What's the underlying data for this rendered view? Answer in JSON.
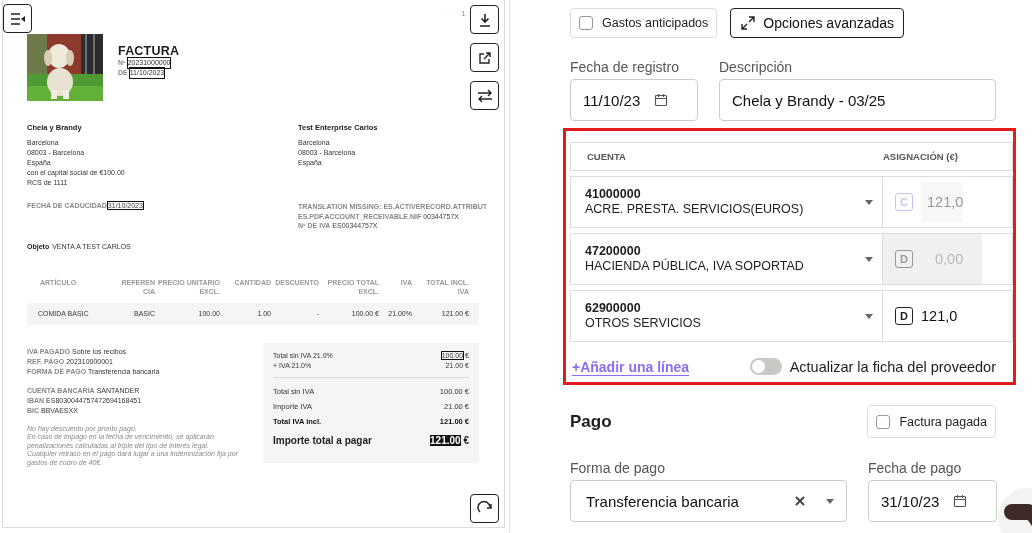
{
  "page_marker": "1",
  "invoice": {
    "title": "FACTURA",
    "number": {
      "label": "Nº",
      "value": "20231000000",
      "boxed": true
    },
    "date": {
      "label": "DE",
      "value": "11/10/2023",
      "boxed": true
    },
    "seller": {
      "name": "Chela y Brandy",
      "lines": [
        "Barcelona",
        "08003 - Barcelona",
        "España",
        "con el capital social de €100.00",
        "RCS de 1111"
      ]
    },
    "due": {
      "label": "FECHA DE CADUCIDAD",
      "value": "31/10/2023",
      "boxed": true
    },
    "client": {
      "name": "Test Enterprise Carlos",
      "lines": [
        "Barcelona",
        "08003 - Barcelona",
        "España"
      ]
    },
    "client_ids": [
      {
        "label": "TRANSLATION MISSING: ES.ACTIVERECORD.ATTRIBUTES.PDF.ACCOUNT_RECEIVABLE.NIF",
        "value": "00344757X"
      },
      {
        "label": "Nº DE IVA",
        "value": "ES00344757X"
      }
    ],
    "subject": {
      "label": "Objeto",
      "value": "VENTA A TEST CARLOS"
    },
    "columns": [
      "ARTÍCULO",
      "REFERENCIA",
      "PRECIO UNITARIO EXCL.",
      "CANTIDAD",
      "DESCUENTO",
      "PRECIO TOTAL EXCL.",
      "IVA",
      "TOTAL INCL. IVA"
    ],
    "rows": [
      [
        "COMIDA BASIC",
        "BASIC",
        "100.00",
        "1.00",
        "-",
        "100.00 €",
        "21.00%",
        "121.00 €"
      ]
    ],
    "payment_info": [
      {
        "label": "IVA PAGADO",
        "value": "Sobre los recibos"
      },
      {
        "label": "REF. PAGO",
        "value": "202310000001"
      },
      {
        "label": "FORMA DE PAGO",
        "value": "Transferencia bancaria"
      }
    ],
    "bank": [
      {
        "label": "CUENTA BANCARIA",
        "value": "SANTANDER"
      },
      {
        "label": "IBAN",
        "value": "ES8030044757472694168451"
      },
      {
        "label": "BIC",
        "value": "BBVAESXX"
      }
    ],
    "notes": [
      "No hay descuento por pronto pago.",
      "En caso de impago en la fecha de vencimiento, se aplicarán penalizaciones calculadas al triple del tipo de interés legal.",
      "Cualquier retraso en el pago dará lugar a una indemnización fija por gastos de cobro de 40€."
    ],
    "tax_lines": [
      {
        "label": "Total sin IVA",
        "rate": "21.0%",
        "value": "100.00",
        "currency": "€",
        "boxed": true
      },
      {
        "label": "+  IVA",
        "rate": "21.0%",
        "value": "21.00",
        "currency": "€",
        "boxed": false
      }
    ],
    "totals": [
      {
        "label": "Total sin IVA",
        "value": "100.00 €",
        "kind": "normal"
      },
      {
        "label": "Importe IVA",
        "value": "21.00 €",
        "kind": "normal"
      },
      {
        "label": "Total IVA incl.",
        "value": "121.00 €",
        "kind": "bold"
      }
    ],
    "grand_total": {
      "label": "Importe total a pagar",
      "value": "121.00",
      "currency": "€",
      "boxed": true
    }
  },
  "form": {
    "advance_expenses": {
      "label": "Gastos anticipados",
      "checked": false
    },
    "advanced_options": {
      "label": "Opciones avanzadas"
    },
    "registration_date": {
      "label": "Fecha de registro",
      "value": "11/10/23"
    },
    "description": {
      "label": "Descripción",
      "value": "Chela y Brandy - 03/25"
    },
    "entries": {
      "columns": [
        "CUENTA",
        "ASIGNACIÓN (€)"
      ],
      "lines": [
        {
          "code": "41000000",
          "name": "ACRE. PRESTA. SERVICIOS(EUROS)",
          "side": "C",
          "amount": "121,0",
          "kind": "readonly"
        },
        {
          "code": "47200000",
          "name": "HACIENDA PÚBLICA, IVA SOPORTAD",
          "side": "D",
          "amount": "0,00",
          "kind": "locked"
        },
        {
          "code": "62900000",
          "name": "OTROS SERVICIOS",
          "side": "D",
          "amount": "121,0",
          "kind": "editable"
        }
      ],
      "add_line": "+Añadir una línea",
      "update_supplier": {
        "label": "Actualizar la ficha del proveedor",
        "on": false
      }
    },
    "payment": {
      "title": "Pago",
      "paid": {
        "label": "Factura pagada",
        "checked": false
      },
      "method": {
        "label": "Forma de pago",
        "value": "Transferencia bancaria"
      },
      "date": {
        "label": "Fecha de pago",
        "value": "31/10/23"
      }
    }
  }
}
